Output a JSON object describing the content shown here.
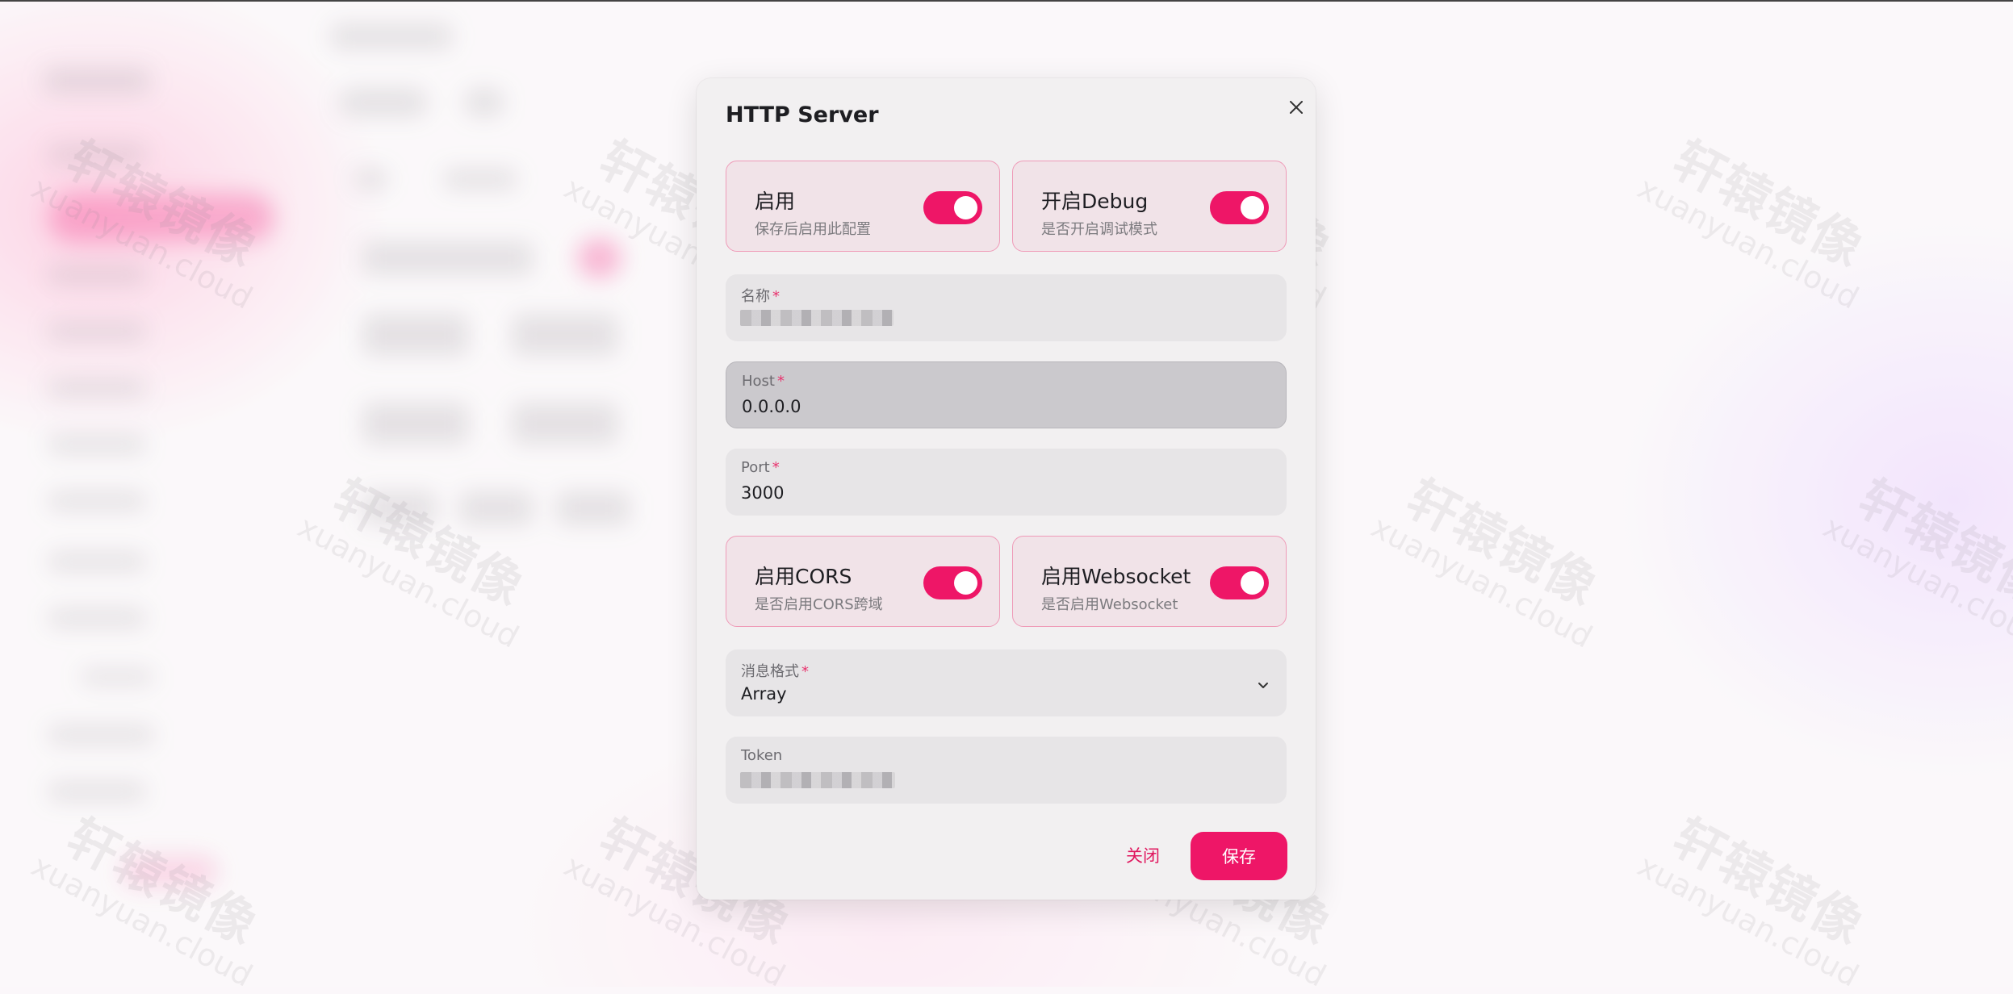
{
  "dialog": {
    "title": "HTTP Server"
  },
  "switches": {
    "enable": {
      "label": "启用",
      "description": "保存后启用此配置",
      "on": true
    },
    "debug": {
      "label": "开启Debug",
      "description": "是否开启调试模式",
      "on": true
    },
    "cors": {
      "label": "启用CORS",
      "description": "是否启用CORS跨域",
      "on": true
    },
    "websocket": {
      "label": "启用Websocket",
      "description": "是否启用Websocket",
      "on": true
    }
  },
  "fields": {
    "name": {
      "label": "名称",
      "required_mark": "*"
    },
    "host": {
      "label": "Host",
      "required_mark": "*",
      "value": "0.0.0.0"
    },
    "port": {
      "label": "Port",
      "required_mark": "*",
      "value": "3000"
    },
    "message_format": {
      "label": "消息格式",
      "required_mark": "*",
      "value": "Array"
    },
    "token": {
      "label": "Token"
    }
  },
  "actions": {
    "close_label": "关闭",
    "save_label": "保存"
  },
  "watermark": {
    "cn": "轩辕镜像",
    "en": "xuanyuan.cloud"
  },
  "colors": {
    "accent": "#ee1667",
    "card_border": "#ef9bb8"
  }
}
